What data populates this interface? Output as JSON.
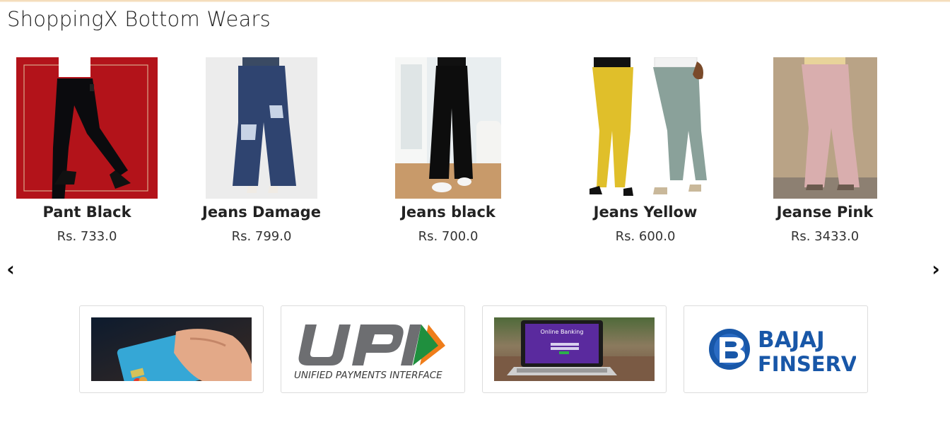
{
  "page": {
    "title": "ShoppingX Bottom Wears"
  },
  "products": [
    {
      "name": "Pant Black",
      "price": "Rs. 733.0",
      "image_icon": "black-pant-model-image"
    },
    {
      "name": "Jeans Damage",
      "price": "Rs. 799.0",
      "image_icon": "ripped-jeans-image"
    },
    {
      "name": "Jeans black",
      "price": "Rs. 700.0",
      "image_icon": "black-flared-pants-image"
    },
    {
      "name": "Jeans Yellow",
      "price": "Rs. 600.0",
      "image_icon": "yellow-and-grey-pants-image"
    },
    {
      "name": "Jeanse Pink",
      "price": "Rs. 3433.0",
      "image_icon": "pink-trousers-image"
    }
  ],
  "carousel": {
    "prev_label": "‹",
    "next_label": "›"
  },
  "payments": {
    "card": {
      "icon": "credit-card-image"
    },
    "upi": {
      "logo_text": "UPI",
      "caption": "UNIFIED PAYMENTS INTERFACE"
    },
    "netbanking": {
      "screen_text": "Online Banking"
    },
    "bajaj": {
      "line1": "BAJAJ",
      "line2": "FINSERV"
    }
  },
  "colors": {
    "top_strip": "#f2d6ae",
    "upi_orange": "#ef7d1a",
    "upi_green": "#1f8f3e",
    "bajaj_blue": "#1857a8"
  }
}
